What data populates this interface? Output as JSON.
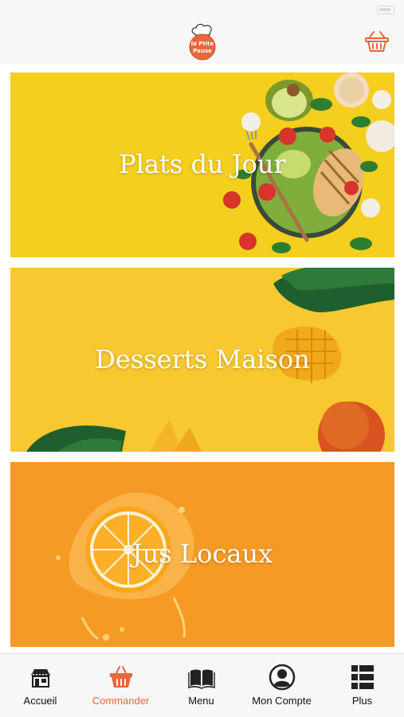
{
  "header": {
    "logo_text_line1": "la Ptite",
    "logo_text_line2": "Pause",
    "cart_icon": "basket-icon"
  },
  "cards": [
    {
      "title": "Plats du Jour"
    },
    {
      "title": "Desserts Maison"
    },
    {
      "title": "Jus Locaux"
    }
  ],
  "tabs": [
    {
      "label": "Accueil",
      "icon": "store-icon"
    },
    {
      "label": "Commander",
      "icon": "basket-icon"
    },
    {
      "label": "Menu",
      "icon": "book-icon"
    },
    {
      "label": "Mon Compte",
      "icon": "user-icon"
    },
    {
      "label": "Plus",
      "icon": "list-icon"
    }
  ],
  "colors": {
    "accent": "#e8673c",
    "card1_bg": "#f4cf1e",
    "card2_bg": "#f7c830",
    "card3_bg": "#f59a24"
  }
}
